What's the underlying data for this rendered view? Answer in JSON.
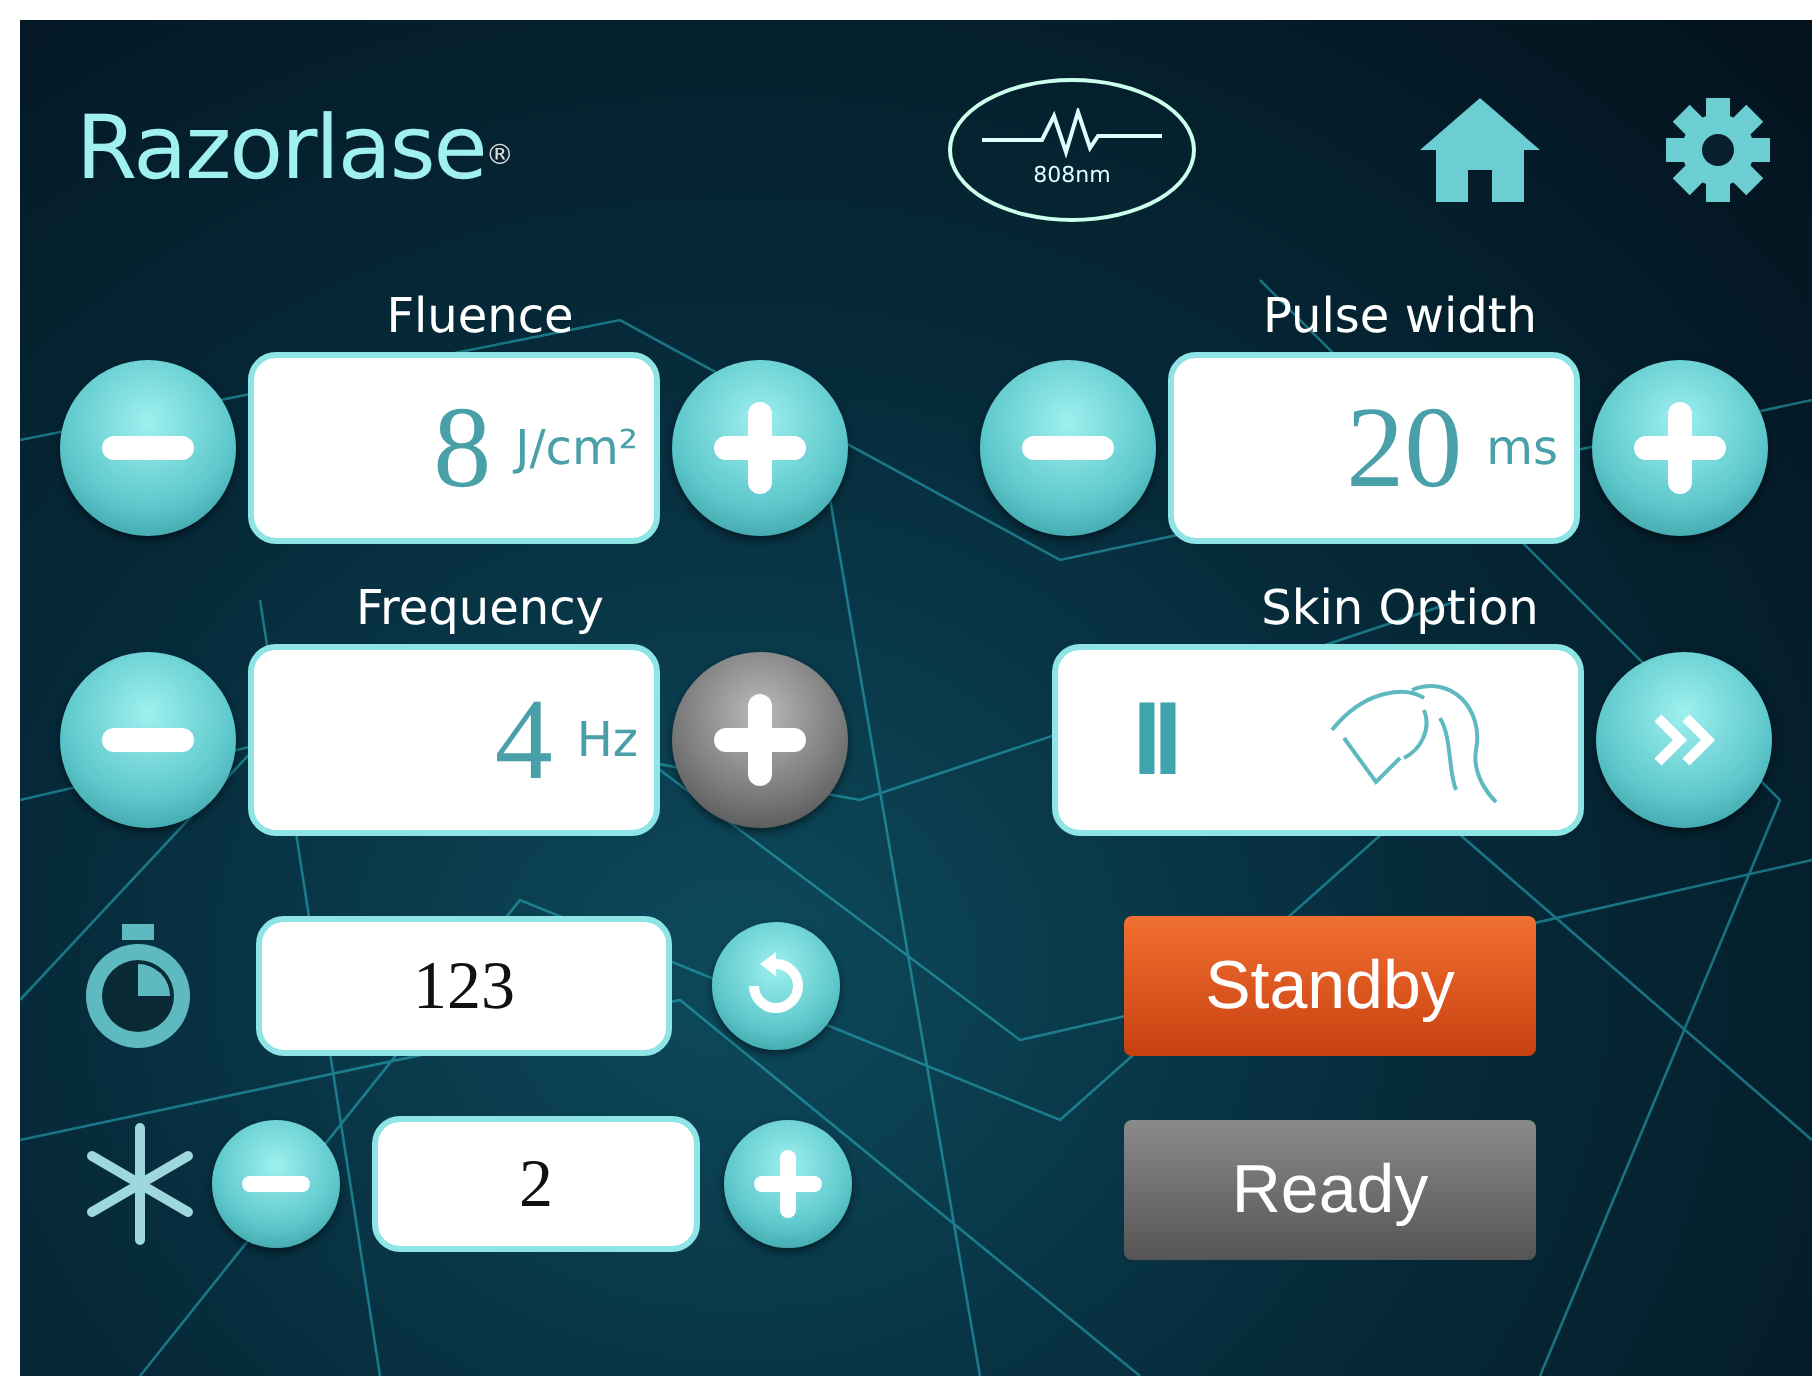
{
  "brand": {
    "name": "Razorlase",
    "mark": "®"
  },
  "wavelength": "808nm",
  "params": [
    {
      "label": "Fluence",
      "value": "8",
      "unit": "J/cm²",
      "plus_disabled": false
    },
    {
      "label": "Pulse width",
      "value": "20",
      "unit": "ms",
      "plus_disabled": false
    },
    {
      "label": "Frequency",
      "value": "4",
      "unit": "Hz",
      "plus_disabled": true
    }
  ],
  "skin_option": {
    "label": "Skin Option",
    "value": "II"
  },
  "counter": "123",
  "cooling": "2",
  "buttons": [
    {
      "label": "Standby",
      "kind": "standby"
    },
    {
      "label": "Ready",
      "kind": "ready"
    }
  ]
}
